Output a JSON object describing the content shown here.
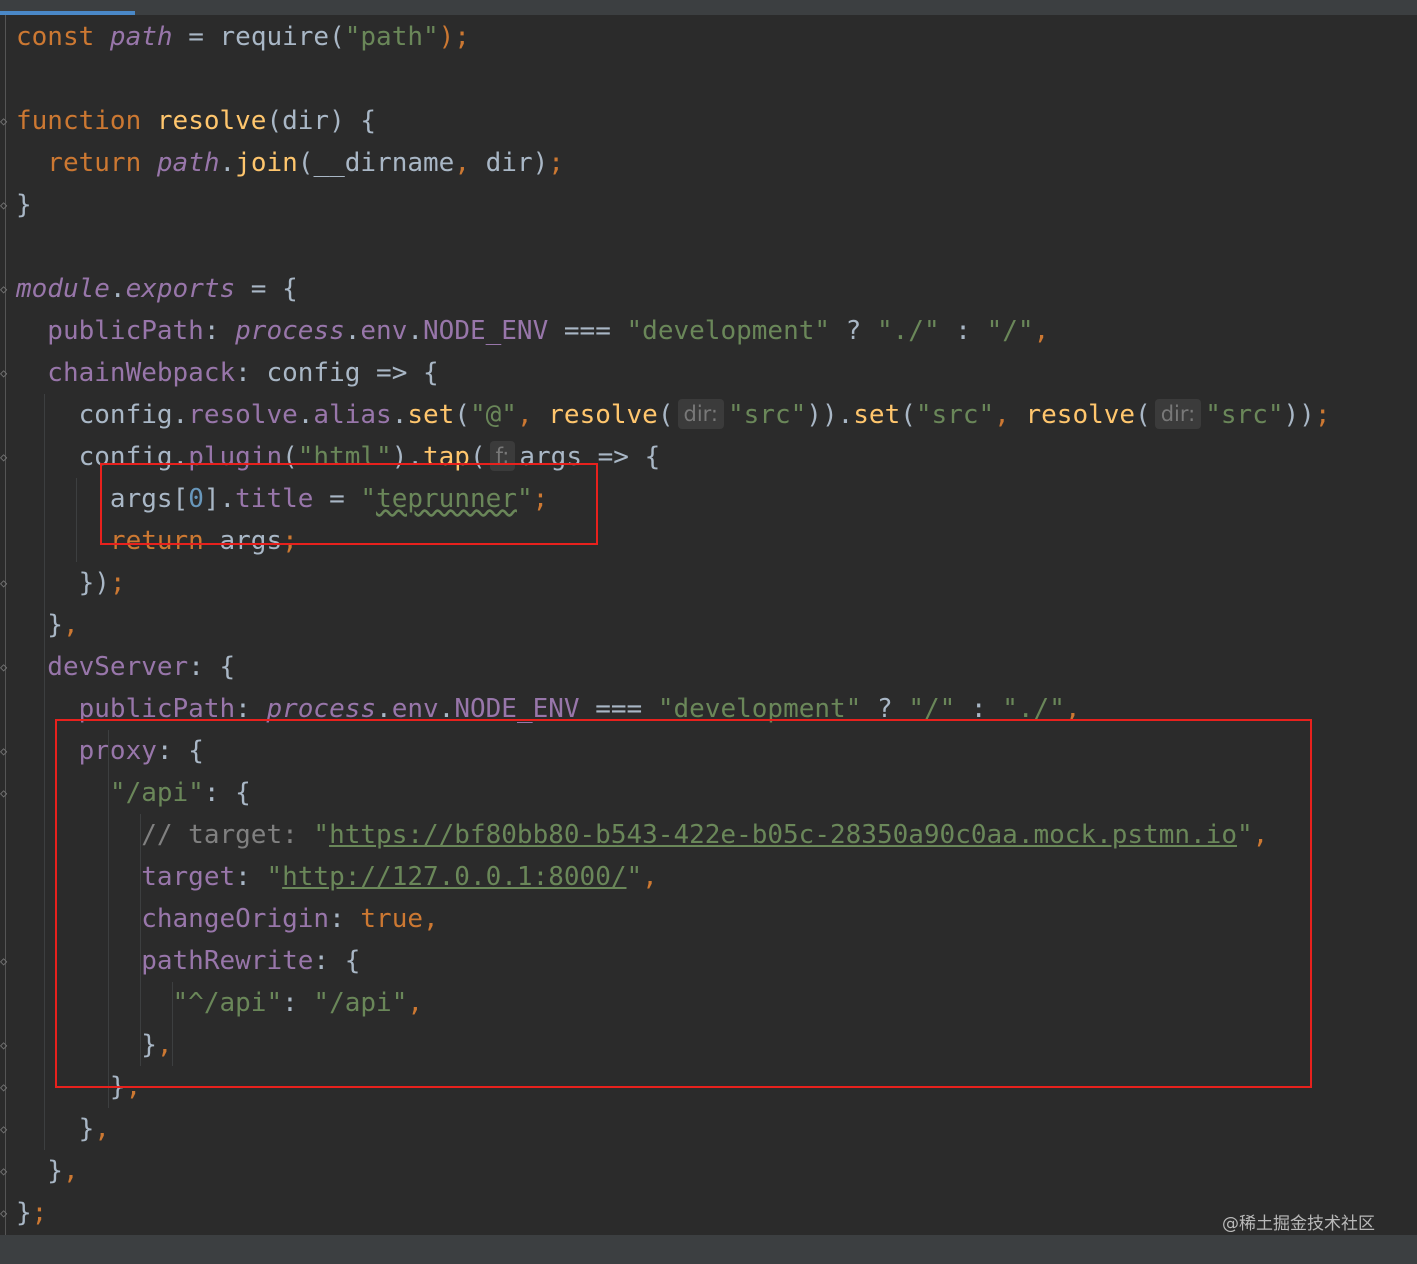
{
  "editor": {
    "lines": [
      {
        "tokens": [
          {
            "t": "const ",
            "c": "kw"
          },
          {
            "t": "path",
            "c": "gvar"
          },
          {
            "t": " = require(",
            "c": ""
          },
          {
            "t": "\"path\"",
            "c": "str"
          },
          {
            "t": ");",
            "c": "kw"
          }
        ]
      },
      {
        "tokens": []
      },
      {
        "tokens": [
          {
            "t": "function ",
            "c": "kw"
          },
          {
            "t": "resolve",
            "c": "fn"
          },
          {
            "t": "(dir) {",
            "c": ""
          }
        ]
      },
      {
        "tokens": [
          {
            "t": "  return ",
            "c": "kw"
          },
          {
            "t": "path",
            "c": "gvar"
          },
          {
            "t": ".",
            "c": ""
          },
          {
            "t": "join",
            "c": "fn"
          },
          {
            "t": "(__dirname",
            "c": ""
          },
          {
            "t": ", ",
            "c": "kw"
          },
          {
            "t": "dir)",
            "c": ""
          },
          {
            "t": ";",
            "c": "kw"
          }
        ]
      },
      {
        "tokens": [
          {
            "t": "}",
            "c": ""
          }
        ]
      },
      {
        "tokens": []
      },
      {
        "tokens": [
          {
            "t": "module",
            "c": "gvar"
          },
          {
            "t": ".",
            "c": ""
          },
          {
            "t": "exports",
            "c": "gvar"
          },
          {
            "t": " = {",
            "c": ""
          }
        ]
      },
      {
        "tokens": [
          {
            "t": "  publicPath",
            "c": "prop"
          },
          {
            "t": ": ",
            "c": ""
          },
          {
            "t": "process",
            "c": "gvar"
          },
          {
            "t": ".",
            "c": ""
          },
          {
            "t": "env",
            "c": "prop"
          },
          {
            "t": ".",
            "c": ""
          },
          {
            "t": "NODE_ENV",
            "c": "prop"
          },
          {
            "t": " === ",
            "c": ""
          },
          {
            "t": "\"development\"",
            "c": "str"
          },
          {
            "t": " ? ",
            "c": ""
          },
          {
            "t": "\"./\"",
            "c": "str"
          },
          {
            "t": " : ",
            "c": ""
          },
          {
            "t": "\"/\"",
            "c": "str"
          },
          {
            "t": ",",
            "c": "kw"
          }
        ]
      },
      {
        "tokens": [
          {
            "t": "  chainWebpack",
            "c": "prop"
          },
          {
            "t": ": config => {",
            "c": ""
          }
        ]
      },
      {
        "tokens": [
          {
            "t": "    config.",
            "c": ""
          },
          {
            "t": "resolve",
            "c": "prop"
          },
          {
            "t": ".",
            "c": ""
          },
          {
            "t": "alias",
            "c": "prop"
          },
          {
            "t": ".",
            "c": ""
          },
          {
            "t": "set",
            "c": "fn"
          },
          {
            "t": "(",
            "c": ""
          },
          {
            "t": "\"@\"",
            "c": "str"
          },
          {
            "t": ", ",
            "c": "kw"
          },
          {
            "t": "resolve",
            "c": "fn"
          },
          {
            "t": "(",
            "c": ""
          },
          {
            "t": "dir:",
            "c": "hint"
          },
          {
            "t": "\"src\"",
            "c": "str"
          },
          {
            "t": ")).",
            "c": ""
          },
          {
            "t": "set",
            "c": "fn"
          },
          {
            "t": "(",
            "c": ""
          },
          {
            "t": "\"src\"",
            "c": "str"
          },
          {
            "t": ", ",
            "c": "kw"
          },
          {
            "t": "resolve",
            "c": "fn"
          },
          {
            "t": "(",
            "c": ""
          },
          {
            "t": "dir:",
            "c": "hint"
          },
          {
            "t": "\"src\"",
            "c": "str"
          },
          {
            "t": "))",
            "c": ""
          },
          {
            "t": ";",
            "c": "kw"
          }
        ]
      },
      {
        "tokens": [
          {
            "t": "    config.",
            "c": ""
          },
          {
            "t": "plugin",
            "c": "prop"
          },
          {
            "t": "(",
            "c": ""
          },
          {
            "t": "\"html\"",
            "c": "str"
          },
          {
            "t": ").",
            "c": ""
          },
          {
            "t": "tap",
            "c": "fn"
          },
          {
            "t": "(",
            "c": ""
          },
          {
            "t": "f:",
            "c": "hint"
          },
          {
            "t": "args => {",
            "c": ""
          }
        ]
      },
      {
        "tokens": [
          {
            "t": "      args[",
            "c": ""
          },
          {
            "t": "0",
            "c": "num"
          },
          {
            "t": "].",
            "c": ""
          },
          {
            "t": "title",
            "c": "prop"
          },
          {
            "t": " = ",
            "c": ""
          },
          {
            "t": "\"",
            "c": "str"
          },
          {
            "t": "teprunner",
            "c": "str squig"
          },
          {
            "t": "\"",
            "c": "str"
          },
          {
            "t": ";",
            "c": "kw"
          }
        ]
      },
      {
        "tokens": [
          {
            "t": "      return ",
            "c": "kw"
          },
          {
            "t": "args",
            "c": ""
          },
          {
            "t": ";",
            "c": "kw"
          }
        ]
      },
      {
        "tokens": [
          {
            "t": "    })",
            "c": ""
          },
          {
            "t": ";",
            "c": "kw"
          }
        ]
      },
      {
        "tokens": [
          {
            "t": "  }",
            "c": ""
          },
          {
            "t": ",",
            "c": "kw"
          }
        ]
      },
      {
        "tokens": [
          {
            "t": "  devServer",
            "c": "prop"
          },
          {
            "t": ": {",
            "c": ""
          }
        ]
      },
      {
        "tokens": [
          {
            "t": "    publicPath",
            "c": "prop"
          },
          {
            "t": ": ",
            "c": ""
          },
          {
            "t": "process",
            "c": "gvar"
          },
          {
            "t": ".",
            "c": ""
          },
          {
            "t": "env",
            "c": "prop"
          },
          {
            "t": ".",
            "c": ""
          },
          {
            "t": "NODE_ENV",
            "c": "prop"
          },
          {
            "t": " === ",
            "c": ""
          },
          {
            "t": "\"development\"",
            "c": "str"
          },
          {
            "t": " ? ",
            "c": ""
          },
          {
            "t": "\"/\"",
            "c": "str"
          },
          {
            "t": " : ",
            "c": ""
          },
          {
            "t": "\"./\"",
            "c": "str"
          },
          {
            "t": ",",
            "c": "kw"
          }
        ]
      },
      {
        "tokens": [
          {
            "t": "    proxy",
            "c": "prop"
          },
          {
            "t": ": {",
            "c": ""
          }
        ]
      },
      {
        "tokens": [
          {
            "t": "      \"/api\"",
            "c": "str"
          },
          {
            "t": ": {",
            "c": ""
          }
        ]
      },
      {
        "tokens": [
          {
            "t": "        // target: ",
            "c": "cmt"
          },
          {
            "t": "\"",
            "c": "str"
          },
          {
            "t": "https://bf80bb80-b543-422e-b05c-28350a90c0aa.mock.pstmn.io",
            "c": "url"
          },
          {
            "t": "\"",
            "c": "str"
          },
          {
            "t": ",",
            "c": "kw"
          }
        ]
      },
      {
        "tokens": [
          {
            "t": "        target",
            "c": "prop"
          },
          {
            "t": ": ",
            "c": ""
          },
          {
            "t": "\"",
            "c": "str"
          },
          {
            "t": "http://127.0.0.1:8000/",
            "c": "url"
          },
          {
            "t": "\"",
            "c": "str"
          },
          {
            "t": ",",
            "c": "kw"
          }
        ]
      },
      {
        "tokens": [
          {
            "t": "        changeOrigin",
            "c": "prop"
          },
          {
            "t": ": ",
            "c": ""
          },
          {
            "t": "true",
            "c": "kw"
          },
          {
            "t": ",",
            "c": "kw"
          }
        ]
      },
      {
        "tokens": [
          {
            "t": "        pathRewrite",
            "c": "prop"
          },
          {
            "t": ": {",
            "c": ""
          }
        ]
      },
      {
        "tokens": [
          {
            "t": "          \"^/api\"",
            "c": "str"
          },
          {
            "t": ": ",
            "c": ""
          },
          {
            "t": "\"/api\"",
            "c": "str"
          },
          {
            "t": ",",
            "c": "kw"
          }
        ]
      },
      {
        "tokens": [
          {
            "t": "        }",
            "c": ""
          },
          {
            "t": ",",
            "c": "kw"
          }
        ]
      },
      {
        "tokens": [
          {
            "t": "      }",
            "c": ""
          },
          {
            "t": ",",
            "c": "kw"
          }
        ]
      },
      {
        "tokens": [
          {
            "t": "    }",
            "c": ""
          },
          {
            "t": ",",
            "c": "kw"
          }
        ]
      },
      {
        "tokens": [
          {
            "t": "  }",
            "c": ""
          },
          {
            "t": ",",
            "c": "kw"
          }
        ]
      },
      {
        "tokens": [
          {
            "t": "}",
            "c": ""
          },
          {
            "t": ";",
            "c": "kw"
          }
        ]
      }
    ]
  },
  "watermark": "@稀土掘金技术社区",
  "colors": {
    "background": "#2b2b2b",
    "keyword": "#cc7832",
    "function": "#ffc66d",
    "property": "#9876aa",
    "string": "#6a8759",
    "number": "#6897bb",
    "comment": "#808080",
    "plain": "#a9b7c6",
    "highlight_box": "#e8211d"
  }
}
